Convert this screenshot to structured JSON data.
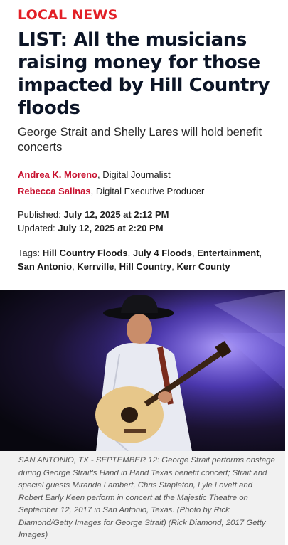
{
  "section": "LOCAL NEWS",
  "headline": "LIST: All the musicians raising money for those impacted by Hill Country floods",
  "subtitle": "George Strait and Shelly Lares will hold benefit concerts",
  "authors": [
    {
      "name": "Andrea K. Moreno",
      "role": ", Digital Journalist"
    },
    {
      "name": "Rebecca Salinas",
      "role": ", Digital Executive Producer"
    }
  ],
  "dates": {
    "published_label": "Published: ",
    "published": "July 12, 2025 at 2:12 PM",
    "updated_label": "Updated: ",
    "updated": "July 12, 2025 at 2:20 PM"
  },
  "tags": {
    "label": "Tags: ",
    "items": [
      "Hill Country Floods",
      "July 4 Floods",
      "Entertainment",
      "San Antonio",
      "Kerrville",
      "Hill Country",
      "Kerr County"
    ]
  },
  "photo": {
    "icon": "concert-photo"
  },
  "caption": "SAN ANTONIO, TX - SEPTEMBER 12: George Strait performs onstage during George Strait's Hand in Hand Texas benefit concert; Strait and special guests Miranda Lambert, Chris Stapleton, Lyle Lovett and Robert Early Keen perform in concert at the Majestic Theatre on September 12, 2017 in San Antonio, Texas. (Photo by Rick Diamond/Getty Images for George Strait) (Rick Diamond, 2017 Getty Images)",
  "colors": {
    "accent": "#e21f26",
    "author_link": "#c8102e",
    "headline": "#0c1527"
  }
}
